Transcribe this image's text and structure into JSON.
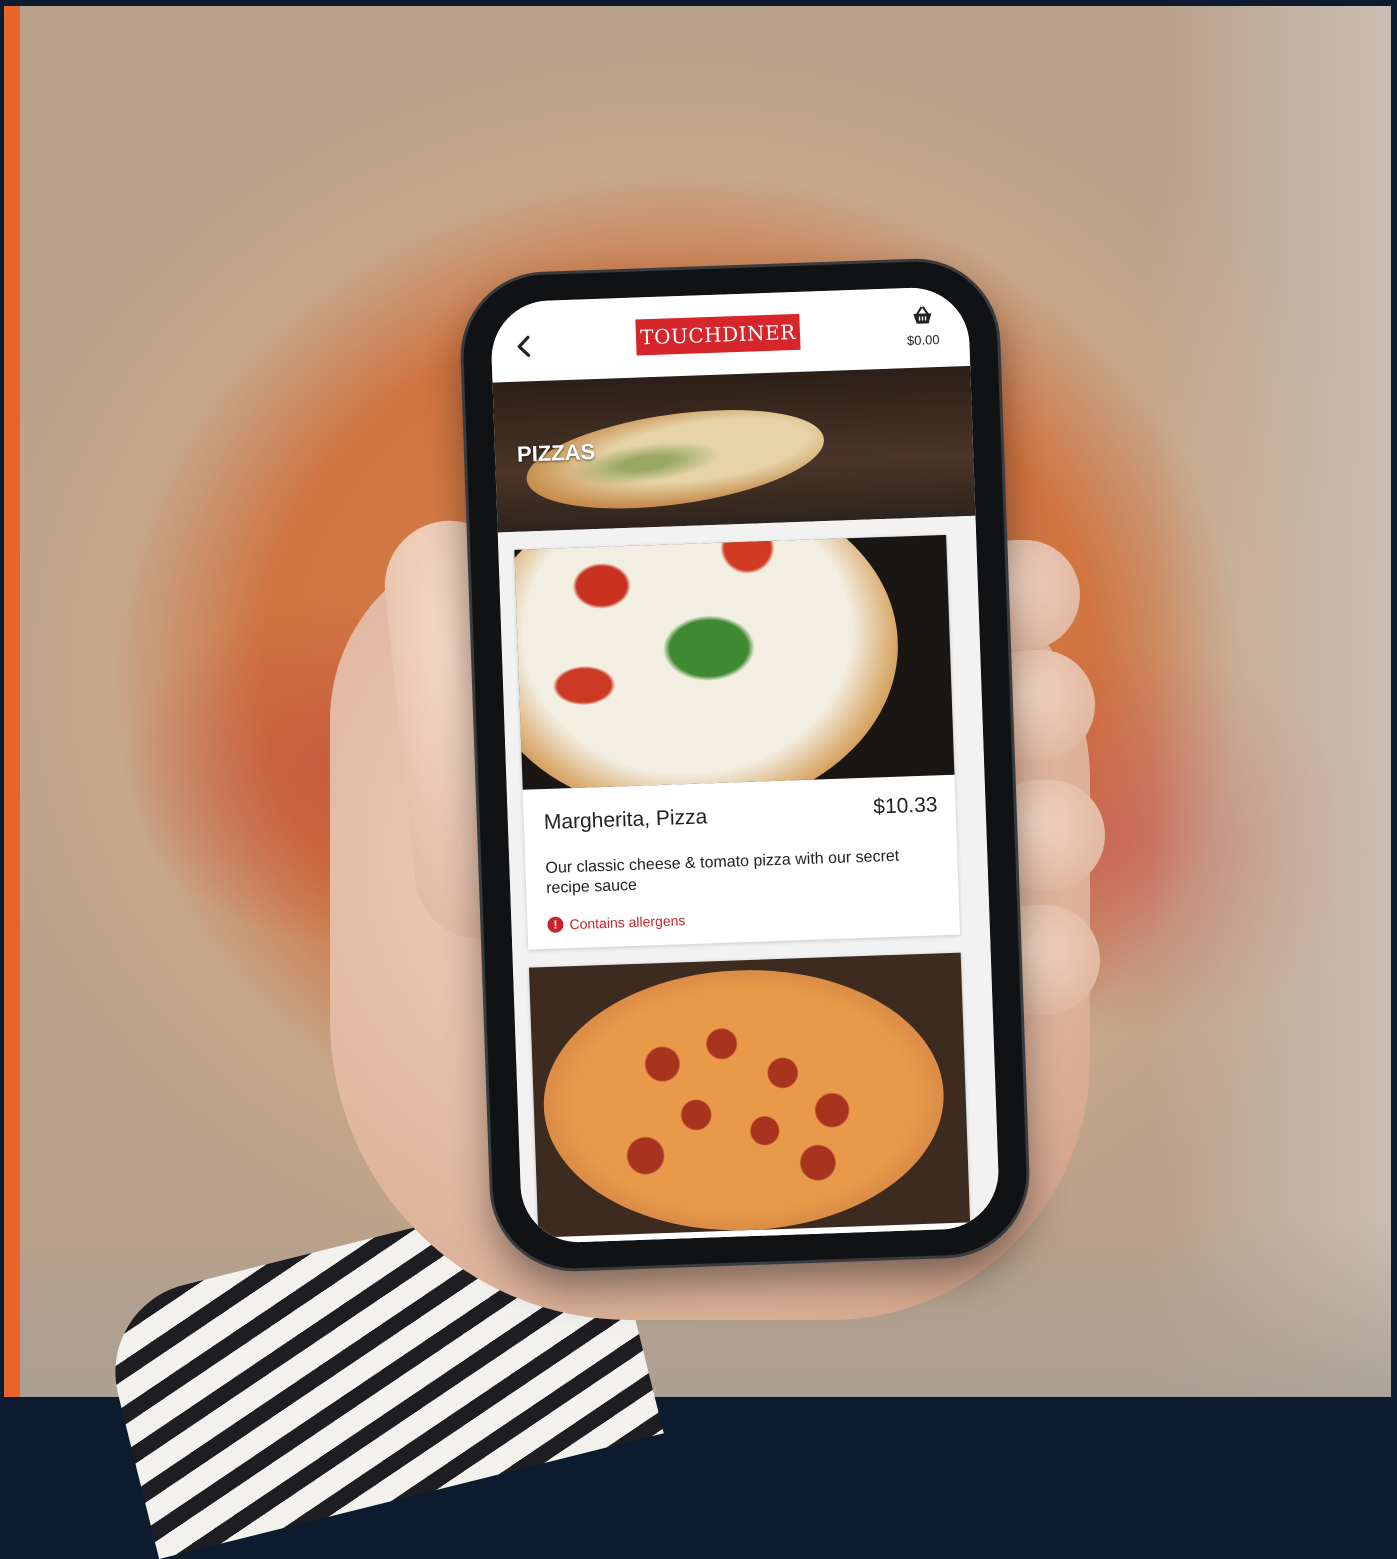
{
  "app": {
    "logo_text": "TOUCHDINER",
    "basket_total": "$0.00",
    "brand_color": "#d7262b"
  },
  "icons": {
    "back": "chevron-left-icon",
    "basket": "basket-icon",
    "allergen": "alert-circle-icon"
  },
  "category": {
    "title": "PIZZAS"
  },
  "items": [
    {
      "name": "Margherita, Pizza",
      "price": "$10.33",
      "description": "Our classic cheese & tomato pizza with our secret recipe sauce",
      "allergen_label": "Contains allergens",
      "allergen_mark": "!"
    }
  ]
}
